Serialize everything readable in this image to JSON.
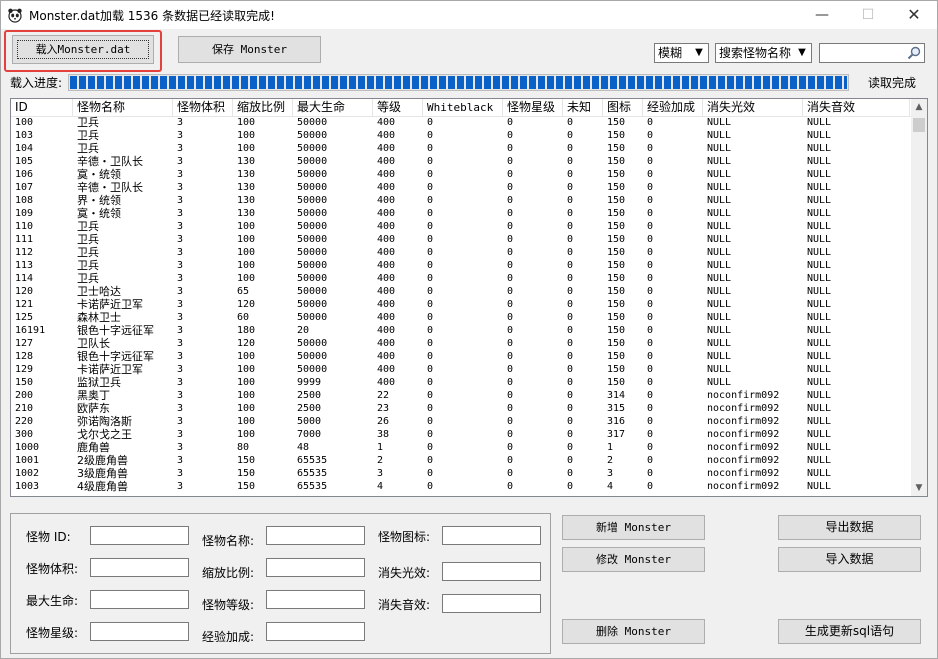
{
  "window": {
    "title": "Monster.dat加载  1536 条数据已经读取完成!",
    "minimize_glyph": "—",
    "maximize_glyph": "☐",
    "close_glyph": "✕"
  },
  "toolbar": {
    "load_label": "载入Monster.dat",
    "save_label": "保存 Monster",
    "match_mode": "模糊",
    "search_field": "搜索怪物名称",
    "search_value": ""
  },
  "progress": {
    "label": "载入进度:",
    "fraction": 1.0,
    "status": "读取完成"
  },
  "table": {
    "columns": [
      "ID",
      "怪物名称",
      "怪物体积",
      "缩放比例",
      "最大生命",
      "等级",
      "Whiteblack",
      "怪物星级",
      "未知",
      "图标",
      "经验加成",
      "消失光效",
      "消失音效"
    ],
    "rows": [
      [
        "100",
        "卫兵",
        "3",
        "100",
        "50000",
        "400",
        "0",
        "0",
        "0",
        "150",
        "0",
        "NULL",
        "NULL"
      ],
      [
        "103",
        "卫兵",
        "3",
        "100",
        "50000",
        "400",
        "0",
        "0",
        "0",
        "150",
        "0",
        "NULL",
        "NULL"
      ],
      [
        "104",
        "卫兵",
        "3",
        "100",
        "50000",
        "400",
        "0",
        "0",
        "0",
        "150",
        "0",
        "NULL",
        "NULL"
      ],
      [
        "105",
        "辛德・卫队长",
        "3",
        "130",
        "50000",
        "400",
        "0",
        "0",
        "0",
        "150",
        "0",
        "NULL",
        "NULL"
      ],
      [
        "106",
        "寞・统领",
        "3",
        "130",
        "50000",
        "400",
        "0",
        "0",
        "0",
        "150",
        "0",
        "NULL",
        "NULL"
      ],
      [
        "107",
        "辛德・卫队长",
        "3",
        "130",
        "50000",
        "400",
        "0",
        "0",
        "0",
        "150",
        "0",
        "NULL",
        "NULL"
      ],
      [
        "108",
        "界・统领",
        "3",
        "130",
        "50000",
        "400",
        "0",
        "0",
        "0",
        "150",
        "0",
        "NULL",
        "NULL"
      ],
      [
        "109",
        "寞・统领",
        "3",
        "130",
        "50000",
        "400",
        "0",
        "0",
        "0",
        "150",
        "0",
        "NULL",
        "NULL"
      ],
      [
        "110",
        "卫兵",
        "3",
        "100",
        "50000",
        "400",
        "0",
        "0",
        "0",
        "150",
        "0",
        "NULL",
        "NULL"
      ],
      [
        "111",
        "卫兵",
        "3",
        "100",
        "50000",
        "400",
        "0",
        "0",
        "0",
        "150",
        "0",
        "NULL",
        "NULL"
      ],
      [
        "112",
        "卫兵",
        "3",
        "100",
        "50000",
        "400",
        "0",
        "0",
        "0",
        "150",
        "0",
        "NULL",
        "NULL"
      ],
      [
        "113",
        "卫兵",
        "3",
        "100",
        "50000",
        "400",
        "0",
        "0",
        "0",
        "150",
        "0",
        "NULL",
        "NULL"
      ],
      [
        "114",
        "卫兵",
        "3",
        "100",
        "50000",
        "400",
        "0",
        "0",
        "0",
        "150",
        "0",
        "NULL",
        "NULL"
      ],
      [
        "120",
        "卫士哈达",
        "3",
        "65",
        "50000",
        "400",
        "0",
        "0",
        "0",
        "150",
        "0",
        "NULL",
        "NULL"
      ],
      [
        "121",
        "卡诺萨近卫军",
        "3",
        "120",
        "50000",
        "400",
        "0",
        "0",
        "0",
        "150",
        "0",
        "NULL",
        "NULL"
      ],
      [
        "125",
        "森林卫士",
        "3",
        "60",
        "50000",
        "400",
        "0",
        "0",
        "0",
        "150",
        "0",
        "NULL",
        "NULL"
      ],
      [
        "16191",
        "银色十字远征军",
        "3",
        "180",
        "20",
        "400",
        "0",
        "0",
        "0",
        "150",
        "0",
        "NULL",
        "NULL"
      ],
      [
        "127",
        "卫队长",
        "3",
        "120",
        "50000",
        "400",
        "0",
        "0",
        "0",
        "150",
        "0",
        "NULL",
        "NULL"
      ],
      [
        "128",
        "银色十字远征军",
        "3",
        "100",
        "50000",
        "400",
        "0",
        "0",
        "0",
        "150",
        "0",
        "NULL",
        "NULL"
      ],
      [
        "129",
        "卡诺萨近卫军",
        "3",
        "100",
        "50000",
        "400",
        "0",
        "0",
        "0",
        "150",
        "0",
        "NULL",
        "NULL"
      ],
      [
        "150",
        "监狱卫兵",
        "3",
        "100",
        "9999",
        "400",
        "0",
        "0",
        "0",
        "150",
        "0",
        "NULL",
        "NULL"
      ],
      [
        "200",
        "黑奥丁",
        "3",
        "100",
        "2500",
        "22",
        "0",
        "0",
        "0",
        "314",
        "0",
        "noconfirm092",
        "NULL"
      ],
      [
        "210",
        "欧萨东",
        "3",
        "100",
        "2500",
        "23",
        "0",
        "0",
        "0",
        "315",
        "0",
        "noconfirm092",
        "NULL"
      ],
      [
        "220",
        "弥诺陶洛斯",
        "3",
        "100",
        "5000",
        "26",
        "0",
        "0",
        "0",
        "316",
        "0",
        "noconfirm092",
        "NULL"
      ],
      [
        "300",
        "戈尔戈之王",
        "3",
        "100",
        "7000",
        "38",
        "0",
        "0",
        "0",
        "317",
        "0",
        "noconfirm092",
        "NULL"
      ],
      [
        "1000",
        "鹿角兽",
        "3",
        "80",
        "48",
        "1",
        "0",
        "0",
        "0",
        "1",
        "0",
        "noconfirm092",
        "NULL"
      ],
      [
        "1001",
        "2级鹿角兽",
        "3",
        "150",
        "65535",
        "2",
        "0",
        "0",
        "0",
        "2",
        "0",
        "noconfirm092",
        "NULL"
      ],
      [
        "1002",
        "3级鹿角兽",
        "3",
        "150",
        "65535",
        "3",
        "0",
        "0",
        "0",
        "3",
        "0",
        "noconfirm092",
        "NULL"
      ],
      [
        "1003",
        "4级鹿角兽",
        "3",
        "150",
        "65535",
        "4",
        "0",
        "0",
        "0",
        "4",
        "0",
        "noconfirm092",
        "NULL"
      ]
    ],
    "scroll_up_glyph": "▲",
    "scroll_down_glyph": "▼"
  },
  "form": {
    "id_label": "怪物  ID:",
    "volume_label": "怪物体积:",
    "maxhp_label": "最大生命:",
    "star_label": "怪物星级:",
    "name_label": "怪物名称:",
    "scale_label": "缩放比例:",
    "level_label": "怪物等级:",
    "exp_label": "经验加成:",
    "icon_label": "怪物图标:",
    "vanish_light_label": "消失光效:",
    "vanish_sound_label": "消失音效:"
  },
  "actions": {
    "add_label": "新增 Monster",
    "modify_label": "修改 Monster",
    "delete_label": "删除 Monster",
    "export_label": "导出数据",
    "import_label": "导入数据",
    "sql_label": "生成更新sql语句"
  }
}
